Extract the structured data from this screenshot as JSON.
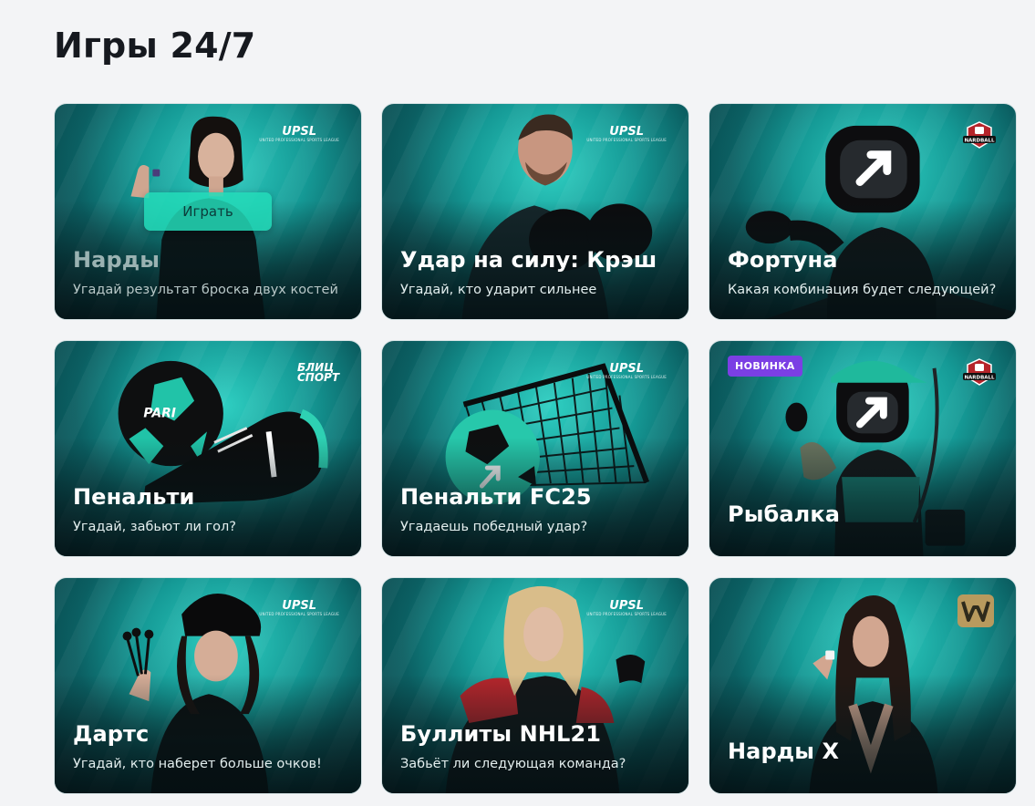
{
  "page": {
    "title": "Игры 24/7"
  },
  "brands": {
    "upsl": "UPSL",
    "upsl_sub": "UNITED PROFESSIONAL SPORTS LEAGUE",
    "blitz_line1": "БЛИЦ",
    "blitz_line2": "СПОРТ",
    "nardball": "NARDBALL"
  },
  "cards": [
    {
      "title": "Нарды",
      "desc": "Угадай результат броска двух костей",
      "play_label": "Играть"
    },
    {
      "title": "Удар на силу: Крэш",
      "desc": "Угадай, кто ударит сильнее"
    },
    {
      "title": "Фортуна",
      "desc": "Какая комбинация будет следующей?"
    },
    {
      "title": "Пенальти",
      "desc": "Угадай, забьют ли гол?"
    },
    {
      "title": "Пенальти FC25",
      "desc": "Угадаешь победный удар?"
    },
    {
      "title": "Рыбалка",
      "badge": "НОВИНКА"
    },
    {
      "title": "Дартс",
      "desc": "Угадай, кто наберет больше очков!"
    },
    {
      "title": "Буллиты NHL21",
      "desc": "Забьёт ли следующая команда?"
    },
    {
      "title": "Нарды X"
    }
  ],
  "art_text": {
    "ball_brand": "PARI"
  }
}
